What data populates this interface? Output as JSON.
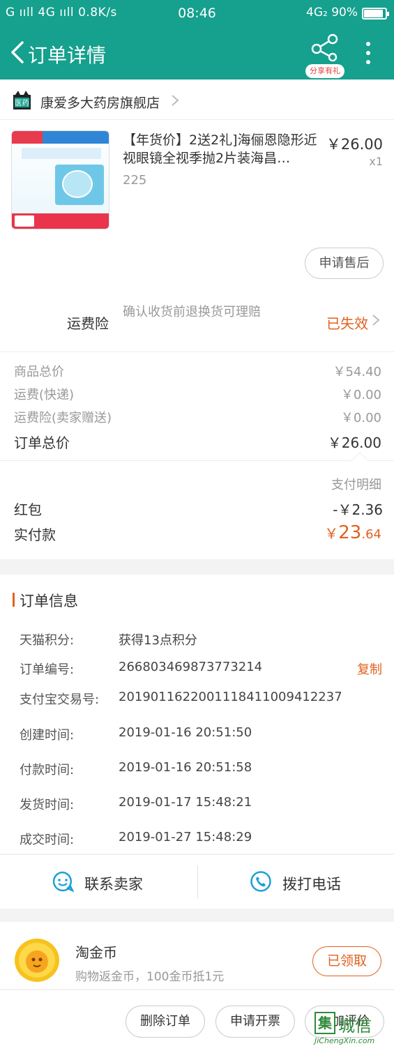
{
  "status_bar": {
    "left": "G ııll 4G ııll 0.8K/s",
    "time": "08:46",
    "network": "4G₂ 90%",
    "battery_level": 0.9
  },
  "header": {
    "title": "订单详情",
    "share_badge": "分享有礼"
  },
  "shop": {
    "icon_label": "医药",
    "name": "康爱多大药房旗舰店"
  },
  "product": {
    "title": "【年货价】2送2礼]海俪恩隐形近视眼镜全视季抛2片装海昌…",
    "sku": "225",
    "price": "￥26.00",
    "qty": "x1",
    "after_sale_label": "申请售后"
  },
  "insurance": {
    "label": "运费险",
    "description": "确认收货前退换货可理赔",
    "status": "已失效"
  },
  "totals": {
    "goods_label": "商品总价",
    "goods_value": "￥54.40",
    "shipping_label": "运费(快递)",
    "shipping_value": "￥0.00",
    "ins_label": "运费险(卖家赠送)",
    "ins_value": "￥0.00",
    "order_total_label": "订单总价",
    "order_total_value": "￥26.00"
  },
  "payment": {
    "detail_label": "支付明细",
    "redpacket_label": "红包",
    "redpacket_value": "-￥2.36",
    "actual_label": "实付款",
    "actual_currency": "￥",
    "actual_int": "23",
    "actual_dec": ".64"
  },
  "order_info": {
    "title": "订单信息",
    "rows": [
      {
        "key": "天猫积分:",
        "value": "获得13点积分"
      },
      {
        "key": "订单编号:",
        "value": "266803469873773214"
      },
      {
        "key": "支付宝交易号:",
        "value": "2019011622001118411009412237"
      },
      {
        "key": "创建时间:",
        "value": "2019-01-16 20:51:50"
      },
      {
        "key": "付款时间:",
        "value": "2019-01-16 20:51:58"
      },
      {
        "key": "发货时间:",
        "value": "2019-01-17 15:48:21"
      },
      {
        "key": "成交时间:",
        "value": "2019-01-27 15:48:29"
      }
    ],
    "copy_label": "复制"
  },
  "contact": {
    "seller_label": "联系卖家",
    "phone_label": "拨打电话"
  },
  "coins": {
    "title": "淘金币",
    "desc": "购物返金币，100金币抵1元",
    "claim_label": "已领取"
  },
  "bottom_bar": {
    "delete_label": "删除订单",
    "invoice_label": "申请开票",
    "review_label": "追加评价"
  },
  "watermark": {
    "logo": "集",
    "name": "城信",
    "url": "JiChengXin.com"
  },
  "colors": {
    "brand": "#16a08e",
    "accent": "#e2611e"
  }
}
